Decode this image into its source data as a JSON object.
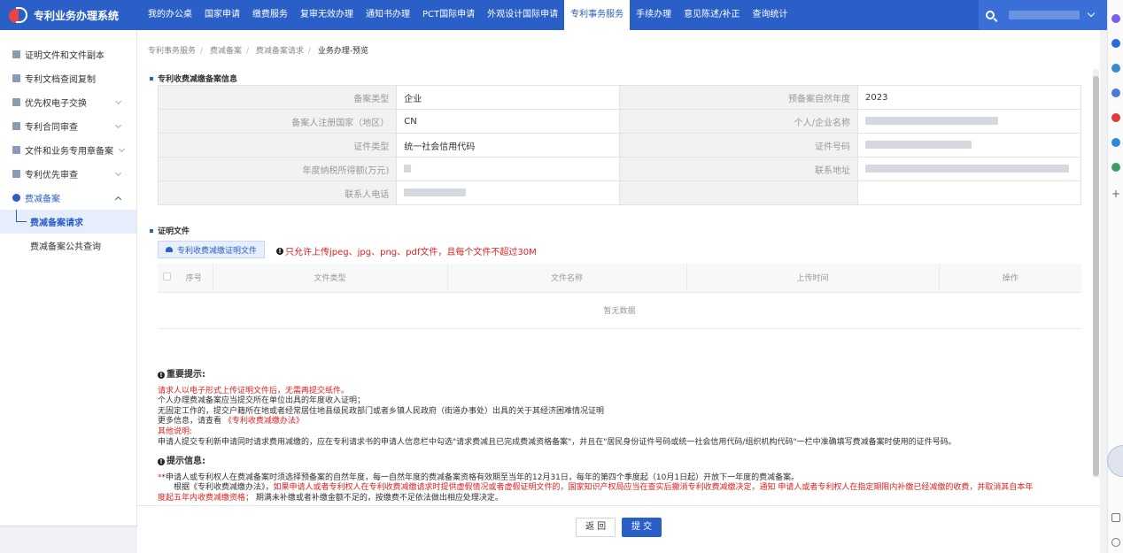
{
  "app": {
    "title": "专利业务办理系统"
  },
  "nav": {
    "items": [
      {
        "label": "我的办公桌"
      },
      {
        "label": "国家申请"
      },
      {
        "label": "缴费服务"
      },
      {
        "label": "复审无效办理"
      },
      {
        "label": "通知书办理"
      },
      {
        "label": "PCT国际申请"
      },
      {
        "label": "外观设计国际申请"
      },
      {
        "label": "专利事务服务"
      },
      {
        "label": "手续办理"
      },
      {
        "label": "意见陈述/补正"
      },
      {
        "label": "查询统计"
      }
    ],
    "active_index": 7
  },
  "sidebar": {
    "items": [
      {
        "label": "证明文件和文件副本"
      },
      {
        "label": "专利文档查阅复制"
      },
      {
        "label": "优先权电子交换"
      },
      {
        "label": "专利合同审查"
      },
      {
        "label": "文件和业务专用章备案"
      },
      {
        "label": "专利优先审查"
      },
      {
        "label": "费减备案"
      }
    ],
    "sub_items": [
      {
        "label": "费减备案请求"
      },
      {
        "label": "费减备案公共查询"
      }
    ]
  },
  "breadcrumb": [
    "专利事务服务",
    "费减备案",
    "费减备案请求",
    "业务办理-预览"
  ],
  "info_section": {
    "title": "专利收费减缴备案信息",
    "rows": [
      {
        "l1": "备案类型",
        "v1": "企业",
        "l2": "预备案自然年度",
        "v2": "2023"
      },
      {
        "l1": "备案人注册国家（地区）",
        "v1": "CN",
        "l2": "个人/企业名称",
        "v2": ""
      },
      {
        "l1": "证件类型",
        "v1": "统一社会信用代码",
        "l2": "证件号码",
        "v2": ""
      },
      {
        "l1": "年度纳税所得额(万元)",
        "v1": "",
        "l2": "联系地址",
        "v2": ""
      },
      {
        "l1": "联系人电话",
        "v1": "",
        "l2": "",
        "v2": ""
      }
    ]
  },
  "files_section": {
    "title": "证明文件",
    "upload_label": "专利收费减缴证明文件",
    "upload_note": "只允许上传jpeg、jpg、png、pdf文件，且每个文件不超过30M",
    "columns": [
      "序号",
      "文件类型",
      "文件名称",
      "上传时间",
      "操作"
    ],
    "empty_text": "暂无数据"
  },
  "notice": {
    "title": "重要提示:",
    "lines": [
      "请求人以电子形式上传证明文件后，无需再提交纸件。",
      "个人办理费减备案应当提交所在单位出具的年度收入证明；",
      "无固定工作的，提交户籍所在地或者经常居住地县级民政部门或者乡镇人民政府（街道办事处）出具的关于其经济困难情况证明",
      "更多信息，请查看",
      "《专利收费减缴办法》",
      "其他说明:",
      "申请人提交专利新申请同时请求费用减缴的，应在专利请求书的申请人信息栏中勾选\"请求费减且已完成费减资格备案\"，并且在\"居民身份证件号码或统一社会信用代码/组织机构代码\"一栏中准确填写费减备案时使用的证件号码。"
    ]
  },
  "tips": {
    "title": "提示信息:",
    "line1": "*申请人或专利权人在费减备案时须选择预备案的自然年度，每一自然年度的费减备案资格有效期至当年的12月31日，每年的第四个季度起（10月1日起）开放下一年度的费减备案。",
    "line2a": "根据《专利收费减缴办法》，",
    "line2b": "如果申请人或者专利权人在专利收费减缴请求时提供虚假情况或者虚假证明文件的，国家知识产权局应当在查实后撤消专利收费减缴决定，通知 申请人或者专利权人在指定期限内补缴已经减缴的收费，并取消其自本年",
    "line3a": "度起五年内收费减缴资格；",
    "line3b": "期满未补缴或者补缴金额不足的，按缴费不足依法做出相应处理决定。"
  },
  "actions": {
    "back": "返 回",
    "submit": "提 交"
  },
  "colors": {
    "primary": "#2a5fc8",
    "danger": "#e02020"
  }
}
